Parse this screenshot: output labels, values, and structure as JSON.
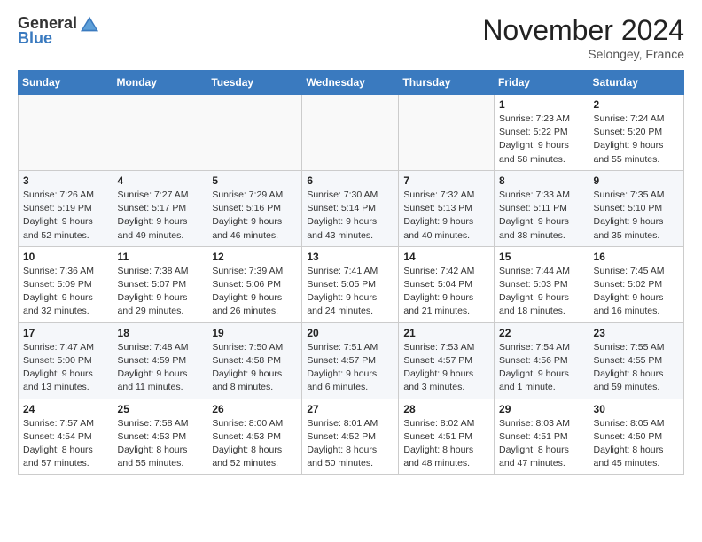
{
  "logo": {
    "general": "General",
    "blue": "Blue"
  },
  "header": {
    "title": "November 2024",
    "subtitle": "Selongey, France"
  },
  "weekdays": [
    "Sunday",
    "Monday",
    "Tuesday",
    "Wednesday",
    "Thursday",
    "Friday",
    "Saturday"
  ],
  "weeks": [
    [
      {
        "day": "",
        "info": ""
      },
      {
        "day": "",
        "info": ""
      },
      {
        "day": "",
        "info": ""
      },
      {
        "day": "",
        "info": ""
      },
      {
        "day": "",
        "info": ""
      },
      {
        "day": "1",
        "info": "Sunrise: 7:23 AM\nSunset: 5:22 PM\nDaylight: 9 hours and 58 minutes."
      },
      {
        "day": "2",
        "info": "Sunrise: 7:24 AM\nSunset: 5:20 PM\nDaylight: 9 hours and 55 minutes."
      }
    ],
    [
      {
        "day": "3",
        "info": "Sunrise: 7:26 AM\nSunset: 5:19 PM\nDaylight: 9 hours and 52 minutes."
      },
      {
        "day": "4",
        "info": "Sunrise: 7:27 AM\nSunset: 5:17 PM\nDaylight: 9 hours and 49 minutes."
      },
      {
        "day": "5",
        "info": "Sunrise: 7:29 AM\nSunset: 5:16 PM\nDaylight: 9 hours and 46 minutes."
      },
      {
        "day": "6",
        "info": "Sunrise: 7:30 AM\nSunset: 5:14 PM\nDaylight: 9 hours and 43 minutes."
      },
      {
        "day": "7",
        "info": "Sunrise: 7:32 AM\nSunset: 5:13 PM\nDaylight: 9 hours and 40 minutes."
      },
      {
        "day": "8",
        "info": "Sunrise: 7:33 AM\nSunset: 5:11 PM\nDaylight: 9 hours and 38 minutes."
      },
      {
        "day": "9",
        "info": "Sunrise: 7:35 AM\nSunset: 5:10 PM\nDaylight: 9 hours and 35 minutes."
      }
    ],
    [
      {
        "day": "10",
        "info": "Sunrise: 7:36 AM\nSunset: 5:09 PM\nDaylight: 9 hours and 32 minutes."
      },
      {
        "day": "11",
        "info": "Sunrise: 7:38 AM\nSunset: 5:07 PM\nDaylight: 9 hours and 29 minutes."
      },
      {
        "day": "12",
        "info": "Sunrise: 7:39 AM\nSunset: 5:06 PM\nDaylight: 9 hours and 26 minutes."
      },
      {
        "day": "13",
        "info": "Sunrise: 7:41 AM\nSunset: 5:05 PM\nDaylight: 9 hours and 24 minutes."
      },
      {
        "day": "14",
        "info": "Sunrise: 7:42 AM\nSunset: 5:04 PM\nDaylight: 9 hours and 21 minutes."
      },
      {
        "day": "15",
        "info": "Sunrise: 7:44 AM\nSunset: 5:03 PM\nDaylight: 9 hours and 18 minutes."
      },
      {
        "day": "16",
        "info": "Sunrise: 7:45 AM\nSunset: 5:02 PM\nDaylight: 9 hours and 16 minutes."
      }
    ],
    [
      {
        "day": "17",
        "info": "Sunrise: 7:47 AM\nSunset: 5:00 PM\nDaylight: 9 hours and 13 minutes."
      },
      {
        "day": "18",
        "info": "Sunrise: 7:48 AM\nSunset: 4:59 PM\nDaylight: 9 hours and 11 minutes."
      },
      {
        "day": "19",
        "info": "Sunrise: 7:50 AM\nSunset: 4:58 PM\nDaylight: 9 hours and 8 minutes."
      },
      {
        "day": "20",
        "info": "Sunrise: 7:51 AM\nSunset: 4:57 PM\nDaylight: 9 hours and 6 minutes."
      },
      {
        "day": "21",
        "info": "Sunrise: 7:53 AM\nSunset: 4:57 PM\nDaylight: 9 hours and 3 minutes."
      },
      {
        "day": "22",
        "info": "Sunrise: 7:54 AM\nSunset: 4:56 PM\nDaylight: 9 hours and 1 minute."
      },
      {
        "day": "23",
        "info": "Sunrise: 7:55 AM\nSunset: 4:55 PM\nDaylight: 8 hours and 59 minutes."
      }
    ],
    [
      {
        "day": "24",
        "info": "Sunrise: 7:57 AM\nSunset: 4:54 PM\nDaylight: 8 hours and 57 minutes."
      },
      {
        "day": "25",
        "info": "Sunrise: 7:58 AM\nSunset: 4:53 PM\nDaylight: 8 hours and 55 minutes."
      },
      {
        "day": "26",
        "info": "Sunrise: 8:00 AM\nSunset: 4:53 PM\nDaylight: 8 hours and 52 minutes."
      },
      {
        "day": "27",
        "info": "Sunrise: 8:01 AM\nSunset: 4:52 PM\nDaylight: 8 hours and 50 minutes."
      },
      {
        "day": "28",
        "info": "Sunrise: 8:02 AM\nSunset: 4:51 PM\nDaylight: 8 hours and 48 minutes."
      },
      {
        "day": "29",
        "info": "Sunrise: 8:03 AM\nSunset: 4:51 PM\nDaylight: 8 hours and 47 minutes."
      },
      {
        "day": "30",
        "info": "Sunrise: 8:05 AM\nSunset: 4:50 PM\nDaylight: 8 hours and 45 minutes."
      }
    ]
  ]
}
